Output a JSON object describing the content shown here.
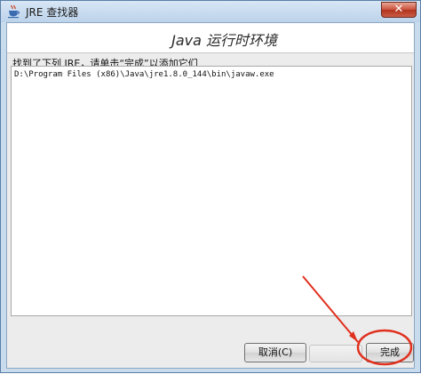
{
  "window": {
    "title": "JRE 查找器",
    "close_label": "✕"
  },
  "header": {
    "title": "Java 运行时环境"
  },
  "main": {
    "found_text": "找到了下列 JRE，请单击“完成”以添加它们",
    "list_items": [
      "D:\\Program Files (x86)\\Java\\jre1.8.0_144\\bin\\javaw.exe"
    ]
  },
  "buttons": {
    "cancel_label": "取消(C)",
    "finish_label": "完成"
  },
  "colors": {
    "annotation": "#e0301e",
    "titlebar": "#c9dcee"
  }
}
